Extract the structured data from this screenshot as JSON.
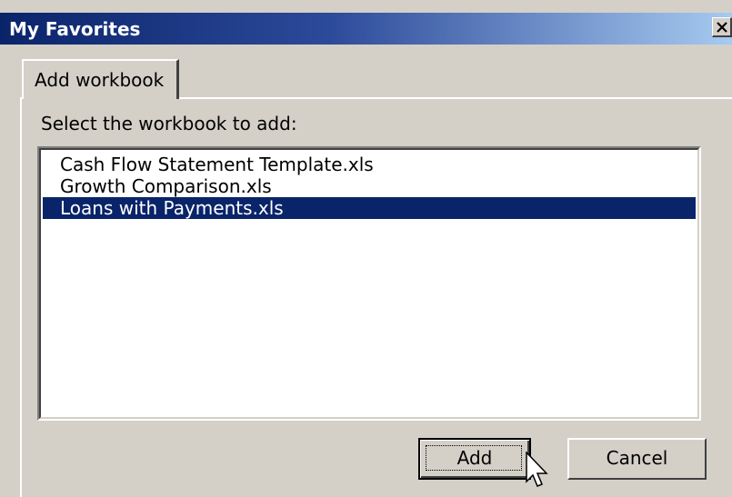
{
  "window": {
    "title": "My Favorites",
    "close_glyph": "✕"
  },
  "tabs": [
    {
      "label": "Add workbook",
      "active": true
    }
  ],
  "prompt": "Select the workbook to add:",
  "workbooks": [
    {
      "name": "Cash Flow Statement Template.xls",
      "selected": false
    },
    {
      "name": "Growth Comparison.xls",
      "selected": false
    },
    {
      "name": "Loans with Payments.xls",
      "selected": true
    }
  ],
  "buttons": {
    "add_label": "Add",
    "cancel_label": "Cancel"
  },
  "colors": {
    "title_gradient_start": "#0a246a",
    "title_gradient_end": "#a6caf0",
    "selection": "#0a246a",
    "dialog_face": "#d4d0c8"
  },
  "cursor_icon": "arrow-pointer-icon"
}
